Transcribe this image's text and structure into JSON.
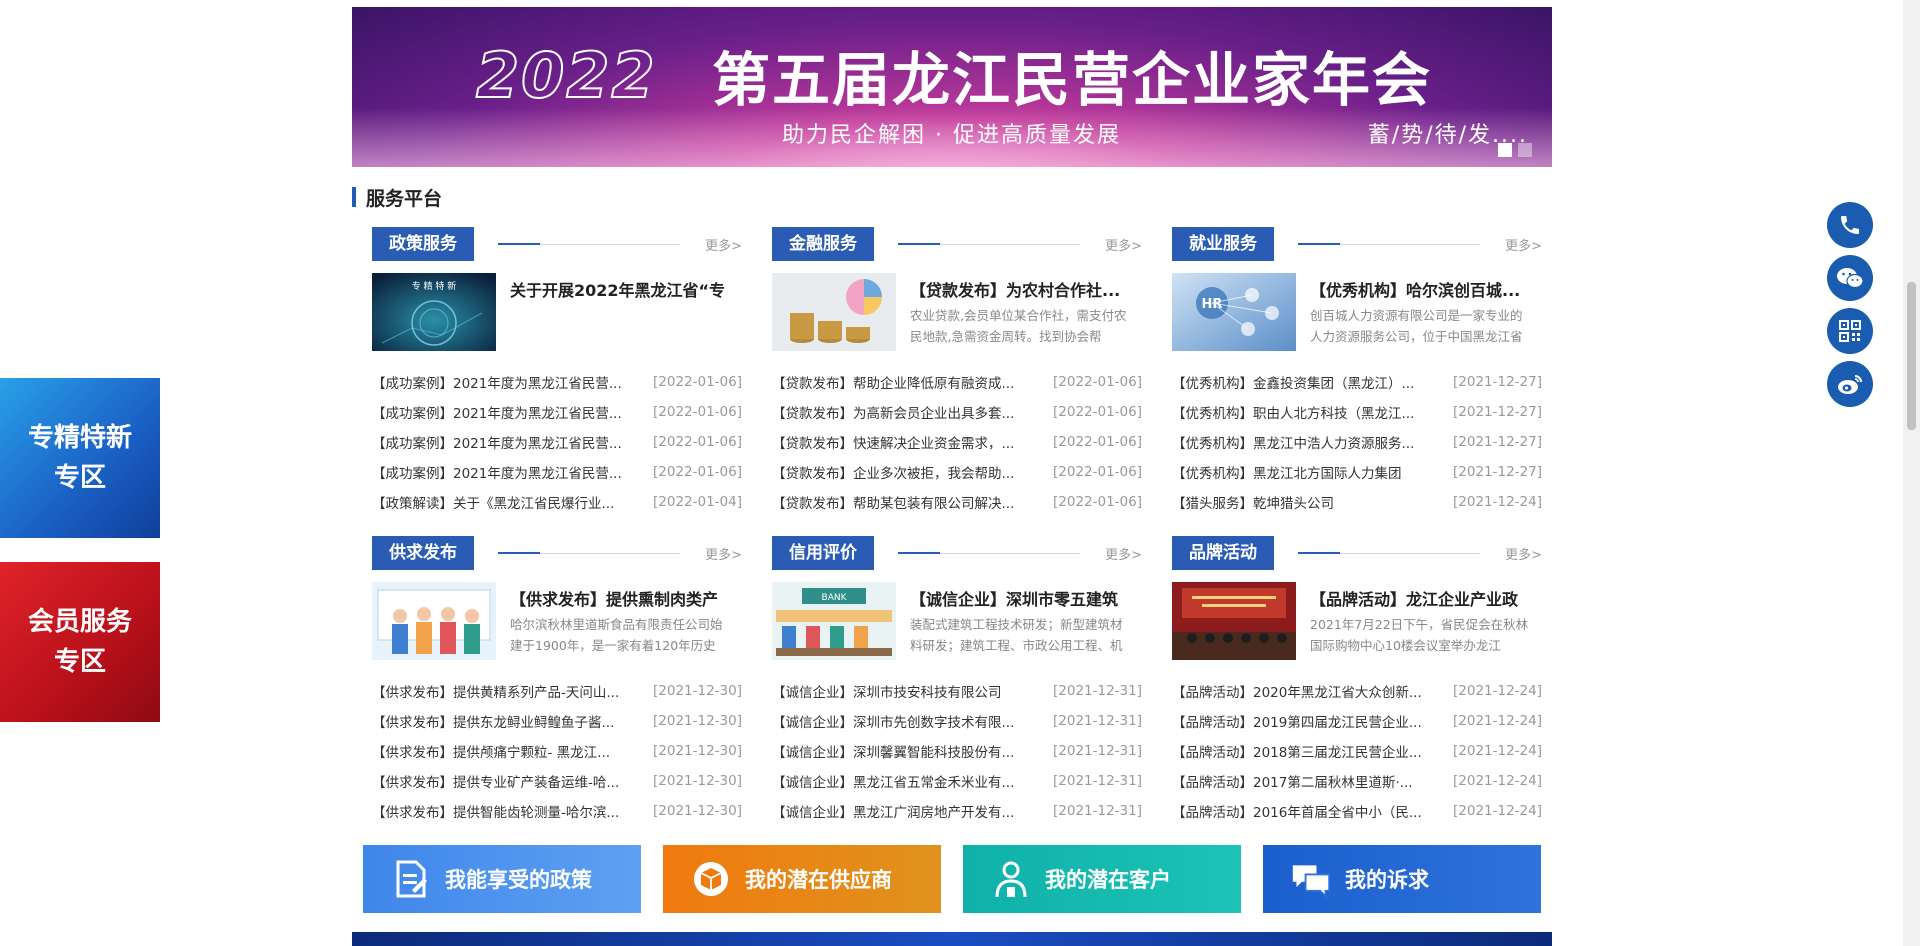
{
  "banner": {
    "year": "2022",
    "title": "第五届龙江民营企业家年会",
    "subtitle": "助力民企解困 · 促进高质量发展",
    "tagline": "蓄/势/待/发....",
    "colors": {
      "primary": "#6a1f8a",
      "glow": "#f7a6d6"
    }
  },
  "section": {
    "title": "服务平台"
  },
  "more_label": "更多>",
  "panels": [
    {
      "tag": "政策服务",
      "feature": {
        "title": "关于开展2022年黑龙江省“专",
        "desc": "",
        "thumb_text": "专 精 特 新"
      },
      "items": [
        {
          "text": "【成功案例】2021年度为黑龙江省民营...",
          "date": "[2022-01-06]"
        },
        {
          "text": "【成功案例】2021年度为黑龙江省民营...",
          "date": "[2022-01-06]"
        },
        {
          "text": "【成功案例】2021年度为黑龙江省民营...",
          "date": "[2022-01-06]"
        },
        {
          "text": "【成功案例】2021年度为黑龙江省民营...",
          "date": "[2022-01-06]"
        },
        {
          "text": "【政策解读】关于《黑龙江省民爆行业...",
          "date": "[2022-01-04]"
        }
      ]
    },
    {
      "tag": "金融服务",
      "feature": {
        "title": "【贷款发布】为农村合作社...",
        "desc": "农业贷款,会员单位某合作社，需支付农民地款,急需资金周转。找到协会帮"
      },
      "items": [
        {
          "text": "【贷款发布】帮助企业降低原有融资成...",
          "date": "[2022-01-06]"
        },
        {
          "text": "【贷款发布】为高新会员企业出具多套...",
          "date": "[2022-01-06]"
        },
        {
          "text": "【贷款发布】快速解决企业资金需求，...",
          "date": "[2022-01-06]"
        },
        {
          "text": "【贷款发布】企业多次被拒，我会帮助...",
          "date": "[2022-01-06]"
        },
        {
          "text": "【贷款发布】帮助某包装有限公司解决...",
          "date": "[2022-01-06]"
        }
      ]
    },
    {
      "tag": "就业服务",
      "feature": {
        "title": "【优秀机构】哈尔滨创百城...",
        "desc": "创百城人力资源有限公司是一家专业的人力资源服务公司，位于中国黑龙江省",
        "thumb_text": "HR"
      },
      "items": [
        {
          "text": "【优秀机构】金鑫投资集团（黑龙江）...",
          "date": "[2021-12-27]"
        },
        {
          "text": "【优秀机构】职由人北方科技（黑龙江...",
          "date": "[2021-12-27]"
        },
        {
          "text": "【优秀机构】黑龙江中浩人力资源服务...",
          "date": "[2021-12-27]"
        },
        {
          "text": "【优秀机构】黑龙江北方国际人力集团",
          "date": "[2021-12-27]"
        },
        {
          "text": "【猎头服务】乾坤猎头公司",
          "date": "[2021-12-24]"
        }
      ]
    },
    {
      "tag": "供求发布",
      "feature": {
        "title": "【供求发布】提供熏制肉类产",
        "desc": "哈尔滨秋林里道斯食品有限责任公司始建于1900年，是一家有着120年历史"
      },
      "items": [
        {
          "text": "【供求发布】提供黄精系列产品-天问山...",
          "date": "[2021-12-30]"
        },
        {
          "text": "【供求发布】提供东龙鲟业鲟鳇鱼子酱...",
          "date": "[2021-12-30]"
        },
        {
          "text": "【供求发布】提供颅痛宁颗粒- 黑龙江...",
          "date": "[2021-12-30]"
        },
        {
          "text": "【供求发布】提供专业矿产装备运维-哈...",
          "date": "[2021-12-30]"
        },
        {
          "text": "【供求发布】提供智能齿轮测量-哈尔滨...",
          "date": "[2021-12-30]"
        }
      ]
    },
    {
      "tag": "信用评价",
      "feature": {
        "title": "【诚信企业】深圳市零五建筑",
        "desc": "装配式建筑工程技术研发；新型建筑材料研发；建筑工程、市政公用工程、机",
        "thumb_text": "BANK"
      },
      "items": [
        {
          "text": "【诚信企业】深圳市技安科技有限公司",
          "date": "[2021-12-31]"
        },
        {
          "text": "【诚信企业】深圳市先创数字技术有限...",
          "date": "[2021-12-31]"
        },
        {
          "text": "【诚信企业】深圳馨翼智能科技股份有...",
          "date": "[2021-12-31]"
        },
        {
          "text": "【诚信企业】黑龙江省五常金禾米业有...",
          "date": "[2021-12-31]"
        },
        {
          "text": "【诚信企业】黑龙江广润房地产开发有...",
          "date": "[2021-12-31]"
        }
      ]
    },
    {
      "tag": "品牌活动",
      "feature": {
        "title": "【品牌活动】龙江企业产业政",
        "desc": "2021年7月22日下午，省民促会在秋林国际购物中心10楼会议室举办龙江"
      },
      "items": [
        {
          "text": "【品牌活动】2020年黑龙江省大众创新...",
          "date": "[2021-12-24]"
        },
        {
          "text": "【品牌活动】2019第四届龙江民营企业...",
          "date": "[2021-12-24]"
        },
        {
          "text": "【品牌活动】2018第三届龙江民营企业...",
          "date": "[2021-12-24]"
        },
        {
          "text": "【品牌活动】2017第二届秋林里道斯·...",
          "date": "[2021-12-24]"
        },
        {
          "text": "【品牌活动】2016年首届全省中小（民...",
          "date": "[2021-12-24]"
        }
      ]
    }
  ],
  "side_tiles": {
    "zhuanjing": {
      "line1": "专精特新",
      "line2": "专区"
    },
    "member": {
      "line1": "会员服务",
      "line2": "专区"
    }
  },
  "float_icons": [
    "phone-icon",
    "wechat-icon",
    "qrcode-icon",
    "weibo-icon"
  ],
  "actions": [
    {
      "label": "我能享受的政策",
      "icon": "document-icon"
    },
    {
      "label": "我的潜在供应商",
      "icon": "box-icon"
    },
    {
      "label": "我的潜在客户",
      "icon": "user-icon"
    },
    {
      "label": "我的诉求",
      "icon": "chat-icon"
    }
  ]
}
